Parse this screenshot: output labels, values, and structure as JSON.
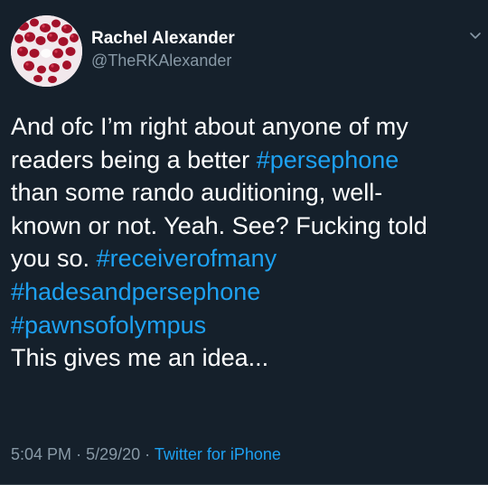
{
  "user": {
    "display_name": "Rachel Alexander",
    "handle": "@TheRKAlexander",
    "avatar_icon": "pomegranate-seeds-avatar"
  },
  "tweet": {
    "lines": [
      [
        {
          "text": "And ofc I’m right about anyone of my",
          "hashtag": false
        }
      ],
      [
        {
          "text": "readers being a better ",
          "hashtag": false
        },
        {
          "text": "#persephone",
          "hashtag": true
        }
      ],
      [
        {
          "text": "than some rando auditioning, well-",
          "hashtag": false
        }
      ],
      [
        {
          "text": "known or not.  Yeah. See? Fucking told",
          "hashtag": false
        }
      ],
      [
        {
          "text": "you so. ",
          "hashtag": false
        },
        {
          "text": "#receiverofmany",
          "hashtag": true
        }
      ],
      [
        {
          "text": "#hadesandpersephone",
          "hashtag": true
        }
      ],
      [
        {
          "text": "#pawnsofolympus",
          "hashtag": true
        }
      ],
      [
        {
          "text": "This gives me an idea...",
          "hashtag": false
        }
      ]
    ],
    "time": "5:04 PM",
    "separator": "·",
    "date": "5/29/20",
    "source": "Twitter for iPhone"
  },
  "icons": {
    "more": "chevron-down-icon"
  },
  "colors": {
    "background": "#15202b",
    "text": "#ffffff",
    "secondary": "#8899a6",
    "link": "#1da1f2"
  }
}
